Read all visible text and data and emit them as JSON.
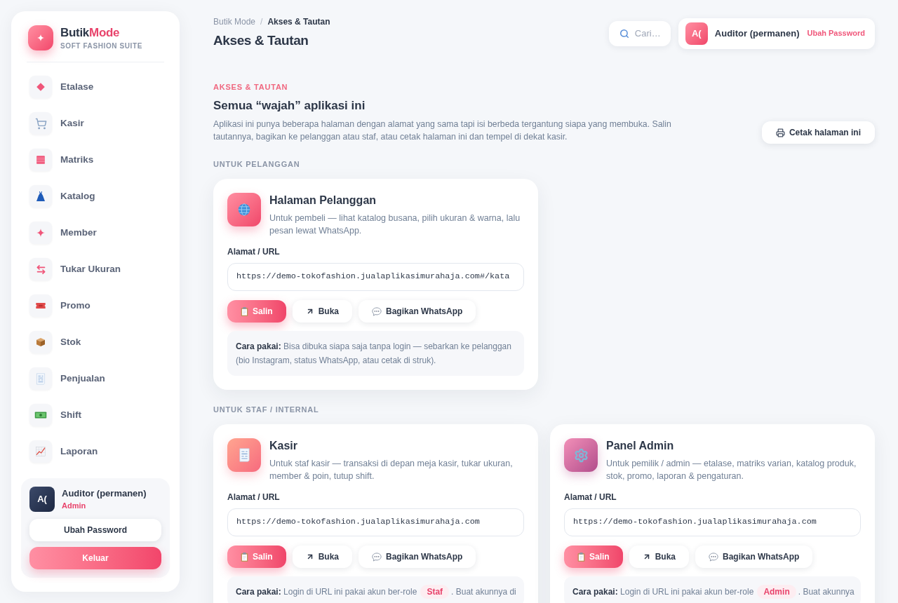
{
  "sidebar": {
    "brand": {
      "name": "Butik",
      "accent": "Mode",
      "tagline": "SOFT FASHION SUITE"
    },
    "items": [
      "Etalase",
      "Kasir",
      "Matriks",
      "Katalog",
      "Member",
      "Tukar Ukuran",
      "Promo",
      "Stok",
      "Penjualan",
      "Shift",
      "Laporan"
    ],
    "user": {
      "initials": "A(",
      "name": "Auditor (permanen)",
      "role": "Admin"
    },
    "buttons": [
      {
        "kind": "secondary",
        "label": "Ubah Password"
      },
      {
        "kind": "primary",
        "label": "Keluar"
      }
    ]
  },
  "header": {
    "breadcrumb": {
      "items": [
        "Butik Mode",
        "Akses & Tautan"
      ],
      "separator": "/"
    },
    "title": "Akses & Tautan",
    "search": {
      "placeholder": "Cari…"
    },
    "user": {
      "initials": "A(",
      "name": "Auditor (permanen)",
      "link": "Ubah Password"
    }
  },
  "intro": {
    "eyebrow": "AKSES & TAUTAN",
    "heading": "Semua “wajah” aplikasi ini",
    "description": "Aplikasi ini punya beberapa halaman dengan alamat yang sama tapi isi berbeda tergantung siapa yang membuka. Salin tautannya, bagikan ke pelanggan atau staf, atau cetak halaman ini dan tempel di dekat kasir.",
    "print_button": "Cetak halaman ini"
  },
  "sections": [
    {
      "label": "UNTUK PELANGGAN",
      "cards": [
        {
          "title": "Halaman Pelanggan",
          "description": "Untuk pembeli — lihat katalog busana, pilih ukuran & warna, lalu pesan lewat WhatsApp.",
          "url_label": "Alamat / URL",
          "url": "https://demo-tokofashion.jualaplikasimurahaja.com#/kata",
          "buttons": [
            {
              "kind": "copy",
              "label": "Salin"
            },
            {
              "kind": "open",
              "label": "Buka"
            },
            {
              "kind": "share",
              "label": "Bagikan WhatsApp"
            }
          ],
          "note": [
            {
              "kind": "text",
              "text": "**Cara pakai:** Bisa dibuka siapa saja tanpa login — sebarkan ke pelanggan (bio Instagram, status WhatsApp, atau cetak di struk)."
            }
          ]
        }
      ]
    },
    {
      "label": "UNTUK STAF / INTERNAL",
      "cards": [
        {
          "title": "Kasir",
          "description": "Untuk staf kasir — transaksi di depan meja kasir, tukar ukuran, member & poin, tutup shift.",
          "url_label": "Alamat / URL",
          "url": "https://demo-tokofashion.jualaplikasimurahaja.com",
          "buttons": [
            {
              "kind": "copy",
              "label": "Salin"
            },
            {
              "kind": "open",
              "label": "Buka"
            },
            {
              "kind": "share",
              "label": "Bagikan WhatsApp"
            }
          ],
          "note": [
            {
              "kind": "text",
              "text": "**Cara pakai:** Login di URL ini pakai akun ber-role"
            },
            {
              "kind": "role",
              "text": "Staf"
            },
            {
              "kind": "text",
              "text": ". Buat akunnya di"
            }
          ]
        },
        {
          "title": "Panel Admin",
          "description": "Untuk pemilik / admin — etalase, matriks varian, katalog produk, stok, promo, laporan & pengaturan.",
          "url_label": "Alamat / URL",
          "url": "https://demo-tokofashion.jualaplikasimurahaja.com",
          "buttons": [
            {
              "kind": "copy",
              "label": "Salin"
            },
            {
              "kind": "open",
              "label": "Buka"
            },
            {
              "kind": "share",
              "label": "Bagikan WhatsApp"
            }
          ],
          "note": [
            {
              "kind": "text",
              "text": "**Cara pakai:** Login di URL ini pakai akun ber-role"
            },
            {
              "kind": "role",
              "text": "Admin"
            },
            {
              "kind": "text",
              "text": ". Buat akunnya"
            }
          ]
        }
      ]
    }
  ]
}
